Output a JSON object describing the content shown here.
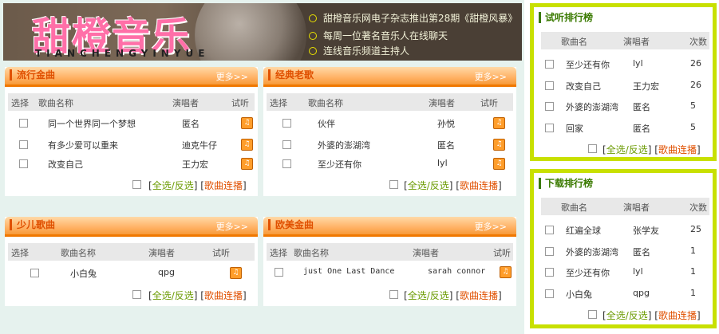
{
  "banner": {
    "logo": "甜橙音乐",
    "logo_sub": "TIANCHENGYINYUE",
    "news": [
      "甜橙音乐网电子杂志推出第28期《甜橙风暴》",
      "每周一位著名音乐人在线聊天",
      "连线音乐频道主持人"
    ]
  },
  "common": {
    "more": "更多>>",
    "select_all": "全选/反选",
    "play_all": "歌曲连播",
    "col_select": "选择",
    "col_song": "歌曲名称",
    "col_singer": "演唱者",
    "col_listen": "试听",
    "lb": "[",
    "rb": "]",
    "lb2": "[",
    "rb2": "]"
  },
  "sections": {
    "popular": {
      "title": "流行金曲",
      "rows": [
        {
          "song": "同一个世界同一个梦想",
          "singer": "匿名"
        },
        {
          "song": "有多少爱可以重来",
          "singer": "迪克牛仔"
        },
        {
          "song": "改变自己",
          "singer": "王力宏"
        }
      ]
    },
    "classic": {
      "title": "经典老歌",
      "rows": [
        {
          "song": "伙伴",
          "singer": "孙悦"
        },
        {
          "song": "外婆的澎湖湾",
          "singer": "匿名"
        },
        {
          "song": "至少还有你",
          "singer": "lyl"
        }
      ]
    },
    "kids": {
      "title": "少儿歌曲",
      "rows": [
        {
          "song": "小白兔",
          "singer": "qpg"
        }
      ]
    },
    "western": {
      "title": "欧美金曲",
      "rows": [
        {
          "song": "just One Last Dance",
          "singer": "sarah connor"
        }
      ]
    }
  },
  "rank_listen": {
    "title": "试听排行榜",
    "col_song": "歌曲名",
    "col_singer": "演唱者",
    "col_count": "次数",
    "rows": [
      {
        "song": "至少还有你",
        "singer": "lyl",
        "count": "26"
      },
      {
        "song": "改变自己",
        "singer": "王力宏",
        "count": "26"
      },
      {
        "song": "外婆的澎湖湾",
        "singer": "匿名",
        "count": "5"
      },
      {
        "song": "回家",
        "singer": "匿名",
        "count": "5"
      }
    ]
  },
  "rank_download": {
    "title": "下载排行榜",
    "col_song": "歌曲名",
    "col_singer": "演唱者",
    "col_count": "次数",
    "rows": [
      {
        "song": "红遍全球",
        "singer": "张学友",
        "count": "25"
      },
      {
        "song": "外婆的澎湖湾",
        "singer": "匿名",
        "count": "1"
      },
      {
        "song": "至少还有你",
        "singer": "lyl",
        "count": "1"
      },
      {
        "song": "小白兔",
        "singer": "qpg",
        "count": "1"
      }
    ]
  },
  "colors": {
    "accent_orange": "#f07800",
    "rank_frame": "#c8e000",
    "banner_bg": "#4a3f35"
  }
}
